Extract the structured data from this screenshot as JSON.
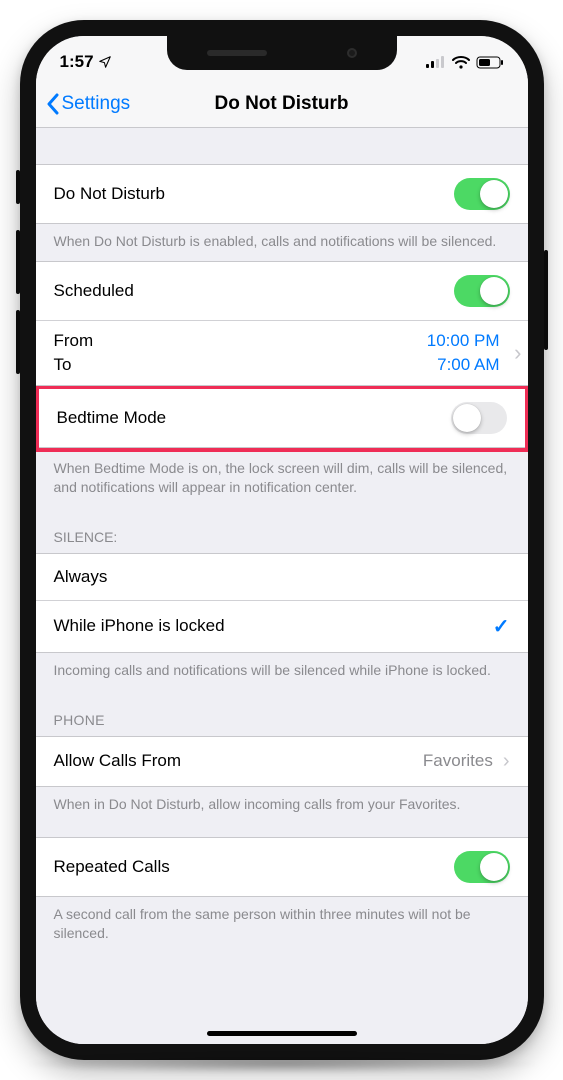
{
  "statusbar": {
    "time": "1:57"
  },
  "nav": {
    "back_label": "Settings",
    "title": "Do Not Disturb"
  },
  "dnd": {
    "label": "Do Not Disturb",
    "footer": "When Do Not Disturb is enabled, calls and notifications will be silenced."
  },
  "scheduled": {
    "label": "Scheduled",
    "from_label": "From",
    "to_label": "To",
    "from_value": "10:00 PM",
    "to_value": "7:00 AM"
  },
  "bedtime": {
    "label": "Bedtime Mode",
    "footer": "When Bedtime Mode is on, the lock screen will dim, calls will be silenced, and notifications will appear in notification center."
  },
  "silence": {
    "header": "SILENCE:",
    "always": "Always",
    "locked": "While iPhone is locked",
    "footer": "Incoming calls and notifications will be silenced while iPhone is locked."
  },
  "phone": {
    "header": "PHONE",
    "allow_label": "Allow Calls From",
    "allow_value": "Favorites",
    "allow_footer": "When in Do Not Disturb, allow incoming calls from your Favorites."
  },
  "repeated": {
    "label": "Repeated Calls",
    "footer": "A second call from the same person within three minutes will not be silenced."
  }
}
